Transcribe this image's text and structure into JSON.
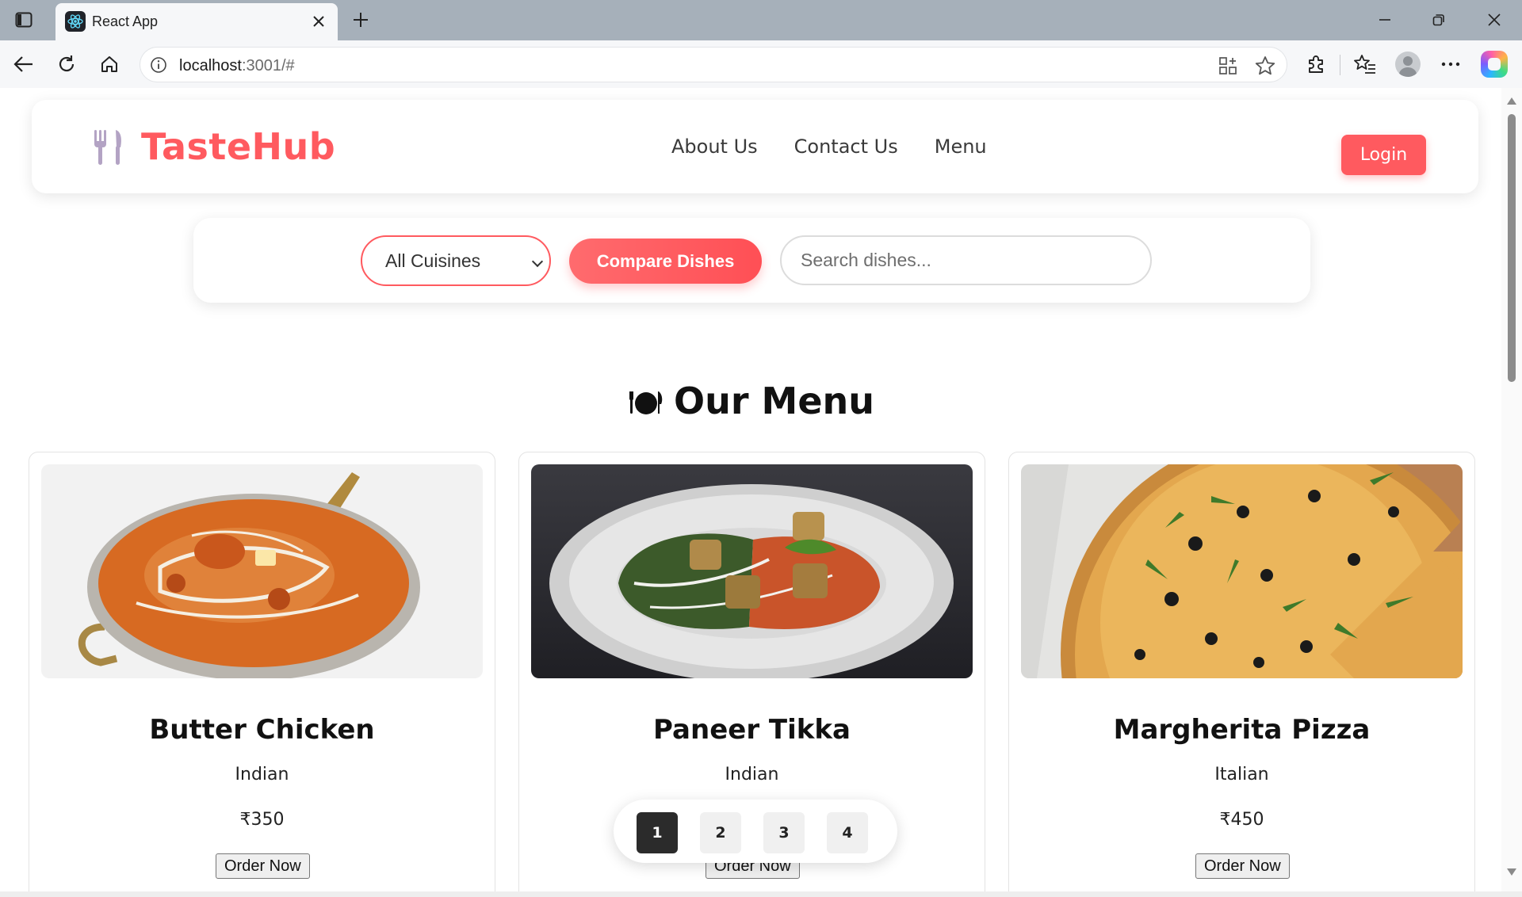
{
  "browser": {
    "tab_title": "React App",
    "url_host": "localhost",
    "url_rest": ":3001/#"
  },
  "header": {
    "logo_text": "TasteHub",
    "nav": [
      "About Us",
      "Contact Us",
      "Menu"
    ],
    "login_label": "Login",
    "brand_color": "#ff5a5f"
  },
  "filters": {
    "cuisine_selected": "All Cuisines",
    "compare_label": "Compare Dishes",
    "search_placeholder": "Search dishes..."
  },
  "menu": {
    "title": "Our Menu",
    "icon": "plate-with-cutlery-icon"
  },
  "dishes": [
    {
      "name": "Butter Chicken",
      "cuisine": "Indian",
      "price": "₹350",
      "order_label": "Order Now",
      "image": "butter-chicken-pan-photo"
    },
    {
      "name": "Paneer Tikka",
      "cuisine": "Indian",
      "price": "₹",
      "order_label": "Order Now",
      "image": "paneer-tikka-plate-photo"
    },
    {
      "name": "Margherita Pizza",
      "cuisine": "Italian",
      "price": "₹450",
      "order_label": "Order Now",
      "image": "margherita-pizza-photo"
    }
  ],
  "pagination": {
    "pages": [
      "1",
      "2",
      "3",
      "4"
    ],
    "current": "1"
  }
}
